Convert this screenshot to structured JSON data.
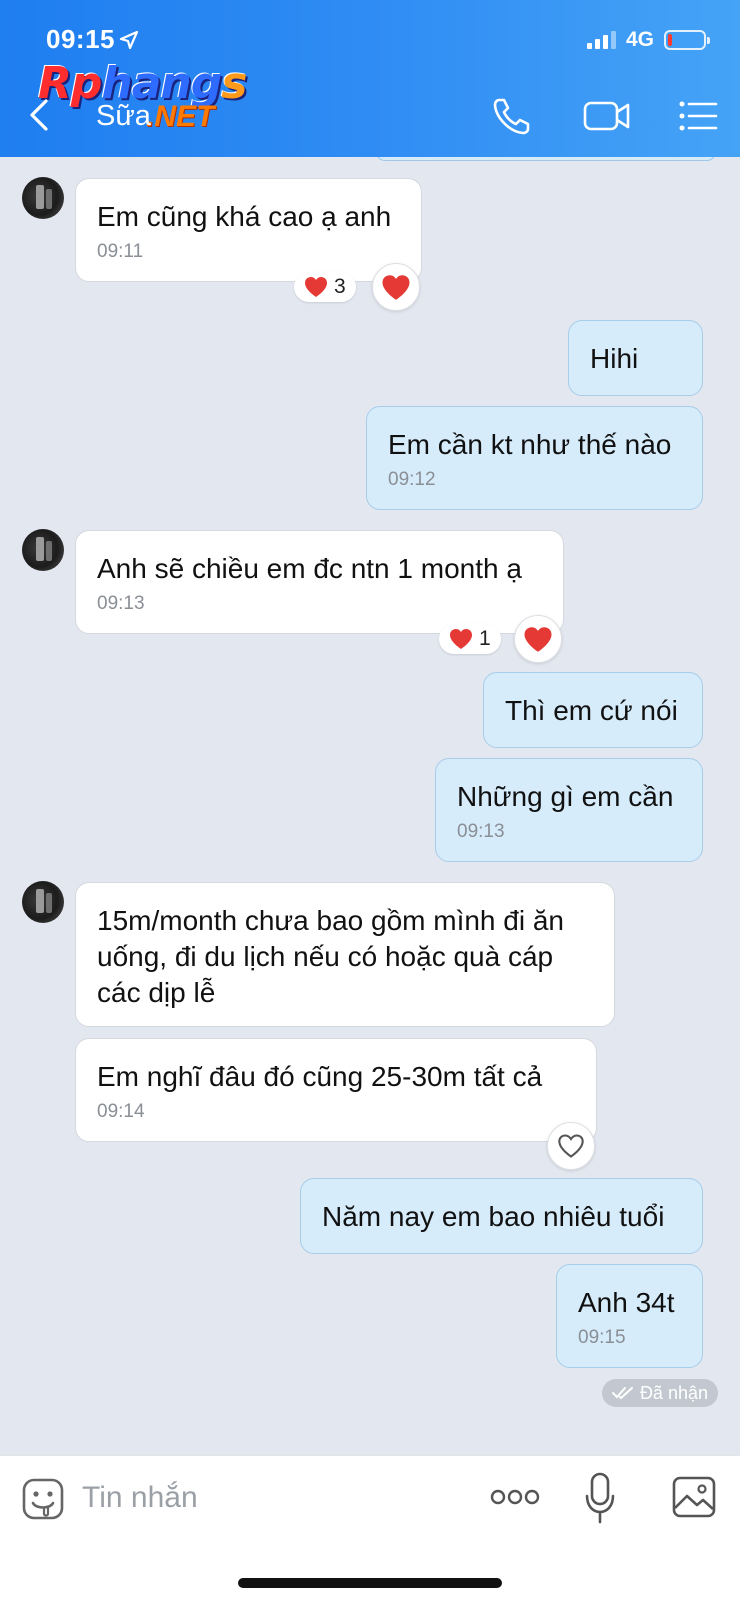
{
  "status_bar": {
    "time": "09:15",
    "network": "4G",
    "battery_level": 0.12
  },
  "watermark": {
    "brand_main": "Rphangs",
    "brand_suffix": ".NET"
  },
  "header": {
    "contact_name": "Sữa",
    "icons": [
      "back-icon",
      "phone-icon",
      "video-camera-icon",
      "menu-icon"
    ]
  },
  "messages": [
    {
      "id": "m1",
      "side": "in",
      "text": "Em cũng khá cao ạ anh",
      "time": "09:11",
      "reactions": {
        "emoji": "heart",
        "count": "3"
      }
    },
    {
      "id": "m2",
      "side": "out",
      "text": "Hihi",
      "time": ""
    },
    {
      "id": "m3",
      "side": "out",
      "text": "Em cần kt như thế nào",
      "time": "09:12"
    },
    {
      "id": "m4",
      "side": "in",
      "text": "Anh sẽ chiều em đc ntn 1 month ạ",
      "time": "09:13",
      "reactions": {
        "emoji": "heart",
        "count": "1"
      }
    },
    {
      "id": "m5",
      "side": "out",
      "text": "Thì em cứ nói",
      "time": ""
    },
    {
      "id": "m6",
      "side": "out",
      "text": "Những gì em cần",
      "time": "09:13"
    },
    {
      "id": "m7",
      "side": "in",
      "text": "15m/month chưa bao gồm mình đi ăn uống, đi du lịch nếu có hoặc quà cáp các dịp lễ",
      "time": ""
    },
    {
      "id": "m8",
      "side": "in",
      "text": "Em nghĩ đâu đó cũng 25-30m tất cả",
      "time": "09:14"
    },
    {
      "id": "m9",
      "side": "out",
      "text": "Năm nay em bao nhiêu tuổi",
      "time": ""
    },
    {
      "id": "m10",
      "side": "out",
      "text": "Anh 34t",
      "time": "09:15"
    }
  ],
  "delivery_status": "Đã nhận",
  "input_bar": {
    "placeholder": "Tin nhắn",
    "icons": [
      "sticker-icon",
      "more-icon",
      "microphone-icon",
      "image-icon"
    ]
  },
  "colors": {
    "header_start": "#1f7ef0",
    "header_end": "#45a3f6",
    "chat_bg": "#e3e7ef",
    "outgoing_bubble": "#d6ecfb",
    "incoming_bubble": "#ffffff",
    "heart": "#e53935"
  }
}
